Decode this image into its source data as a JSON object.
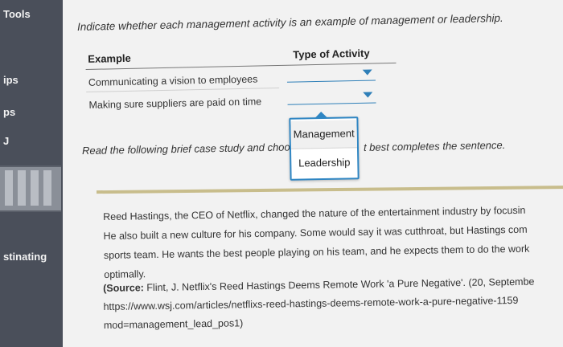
{
  "sidebar": {
    "items": [
      {
        "label": "Tools"
      },
      {
        "label": "ips"
      },
      {
        "label": "ps"
      },
      {
        "label": "J"
      },
      {
        "label": "stinating"
      }
    ]
  },
  "question": {
    "instruction": "Indicate whether each management activity is an example of management or leadership.",
    "table": {
      "headers": [
        "Example",
        "Type of Activity"
      ],
      "rows": [
        {
          "example": "Communicating a vision to employees",
          "selected": ""
        },
        {
          "example": "Making sure suppliers are paid on time",
          "selected": ""
        }
      ]
    },
    "dropdown_options": [
      "Management",
      "Leadership"
    ]
  },
  "case_study": {
    "prompt_left": "Read the following brief case study and choo",
    "prompt_right": "t best completes the sentence.",
    "passage_lines": [
      "Reed Hastings, the CEO of Netflix, changed the nature of the entertainment industry by focusin",
      "He also built a new culture for his company. Some would say it was cutthroat, but Hastings com",
      "sports team. He wants the best people playing on his team, and he expects them to do the work",
      "optimally."
    ],
    "source_label": "(Source:",
    "source_lines": [
      " Flint, J. Netflix's Reed Hastings Deems Remote Work 'a Pure Negative'. (20, Septembe",
      "https://www.wsj.com/articles/netflixs-reed-hastings-deems-remote-work-a-pure-negative-1159",
      "mod=management_lead_pos1)"
    ]
  },
  "colors": {
    "sidebar_bg": "#4a4f5a",
    "accent": "#2f86c3",
    "divider": "#c8bd8c"
  }
}
